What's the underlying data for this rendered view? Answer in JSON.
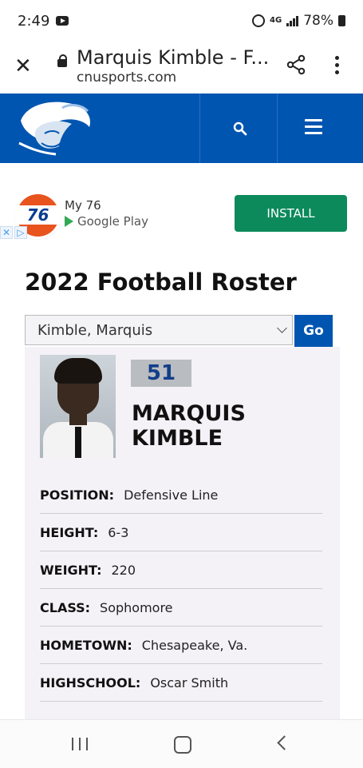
{
  "status_bar": {
    "time": "2:49",
    "network": "4G",
    "battery": "78%"
  },
  "browser": {
    "page_title": "Marquis Kimble - F...",
    "domain": "cnusports.com"
  },
  "ad": {
    "app_name": "My 76",
    "store": "Google Play",
    "icon_text": "76",
    "cta": "INSTALL"
  },
  "roster": {
    "title": "2022 Football Roster",
    "selected_player": "Kimble, Marquis",
    "go_label": "Go"
  },
  "player": {
    "number": "51",
    "name_line1": "MARQUIS",
    "name_line2": "KIMBLE",
    "details": [
      {
        "label": "POSITION:",
        "value": "Defensive Line"
      },
      {
        "label": "HEIGHT:",
        "value": "6-3"
      },
      {
        "label": "WEIGHT:",
        "value": "220"
      },
      {
        "label": "CLASS:",
        "value": "Sophomore"
      },
      {
        "label": "HOMETOWN:",
        "value": "Chesapeake, Va."
      },
      {
        "label": "HIGHSCHOOL:",
        "value": "Oscar Smith"
      }
    ]
  },
  "colors": {
    "brand_blue": "#0055b0",
    "install_green": "#0c8a5b",
    "card_bg": "#f4f1f7"
  },
  "icons": [
    "close-icon",
    "lock-icon",
    "share-icon",
    "more-icon",
    "search-icon",
    "menu-icon",
    "play-store-icon",
    "ad-choices-icon",
    "chevron-down-icon",
    "recent-apps-icon",
    "home-icon",
    "back-icon"
  ]
}
